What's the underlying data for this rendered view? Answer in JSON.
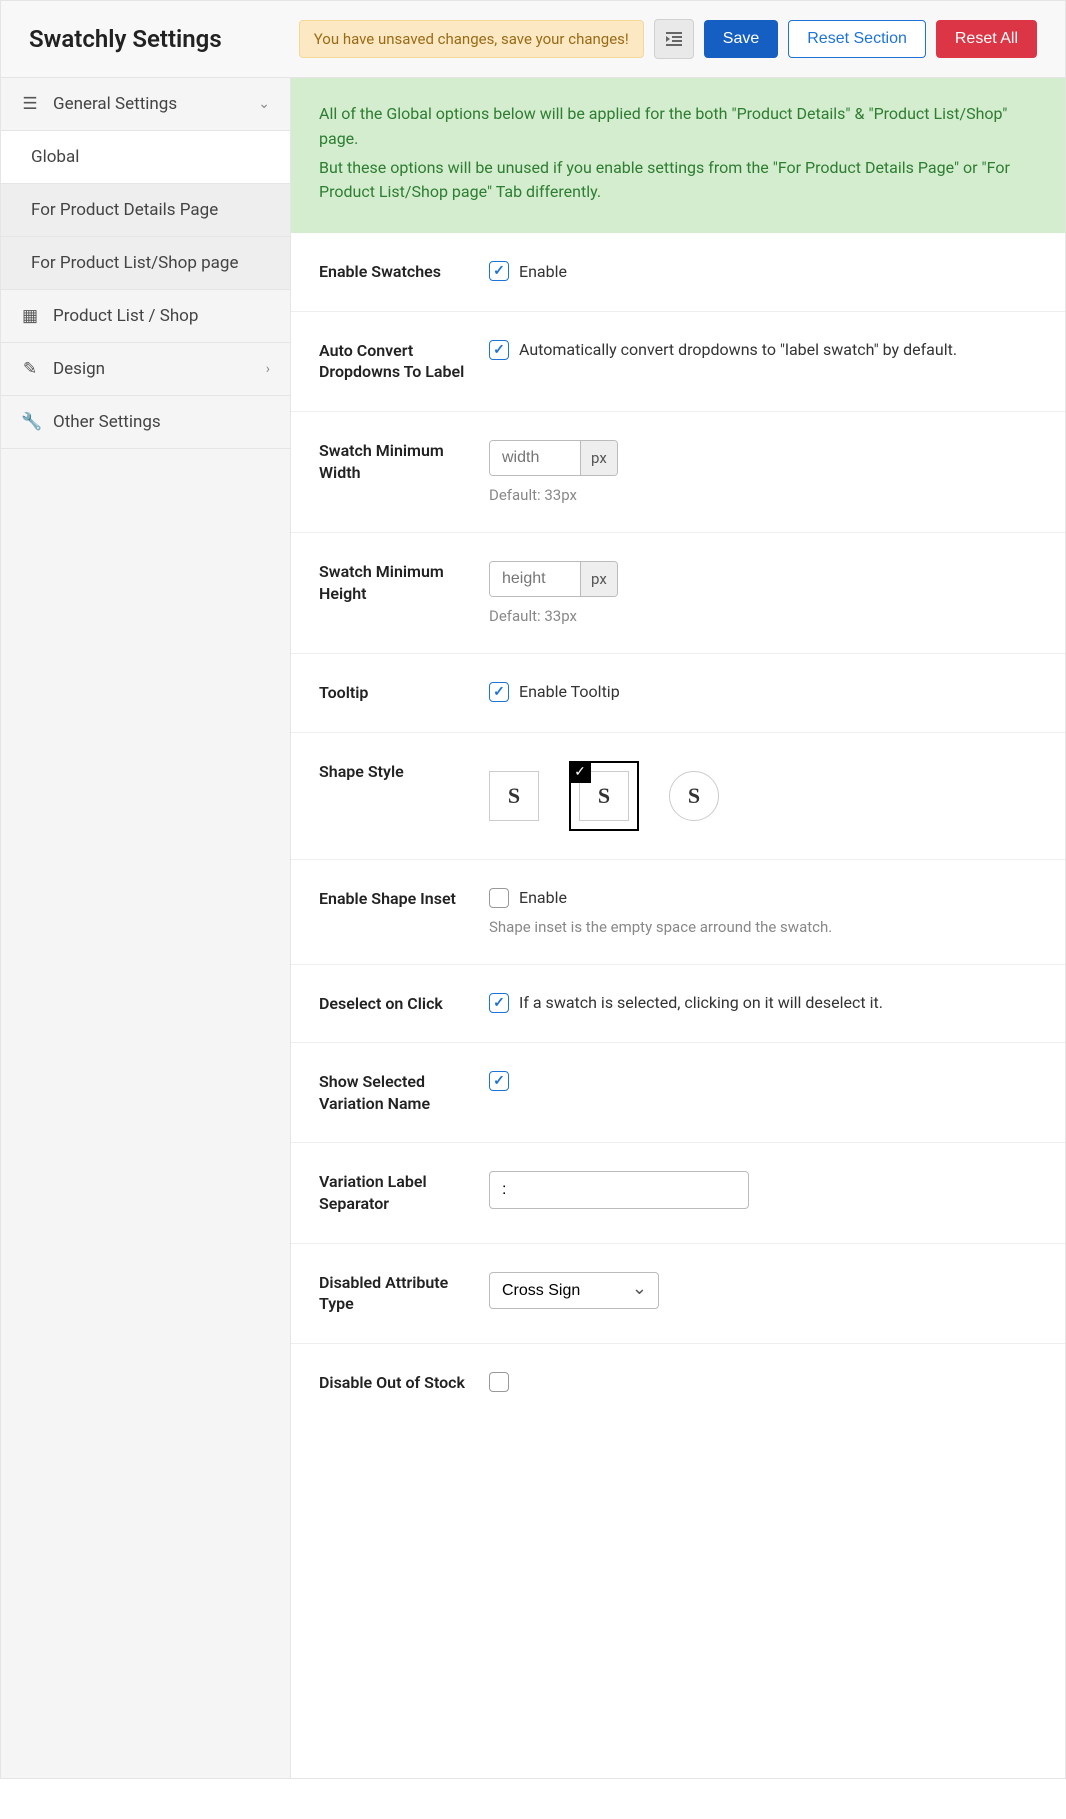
{
  "header": {
    "title": "Swatchly Settings",
    "unsaved_notice": "You have unsaved changes, save your changes!",
    "save": "Save",
    "reset_section": "Reset Section",
    "reset_all": "Reset All"
  },
  "sidebar": {
    "general": "General Settings",
    "global": "Global",
    "for_details": "For Product Details Page",
    "for_list": "For Product List/Shop page",
    "product_list": "Product List / Shop",
    "design": "Design",
    "other": "Other Settings"
  },
  "banner": {
    "line1": "All of the Global options below will be applied for the both \"Product Details\" & \"Product List/Shop\" page.",
    "line2": "But these options will be unused if you enable settings from the \"For Product Details Page\" or \"For Product List/Shop page\" Tab differently."
  },
  "settings": {
    "enable_swatches": {
      "label": "Enable Swatches",
      "checkbox_label": "Enable",
      "checked": true
    },
    "auto_convert": {
      "label": "Auto Convert Dropdowns To Label",
      "checkbox_label": "Automatically convert dropdowns to \"label swatch\" by default.",
      "checked": true
    },
    "min_width": {
      "label": "Swatch Minimum Width",
      "placeholder": "width",
      "unit": "px",
      "help": "Default: 33px"
    },
    "min_height": {
      "label": "Swatch Minimum Height",
      "placeholder": "height",
      "unit": "px",
      "help": "Default: 33px"
    },
    "tooltip": {
      "label": "Tooltip",
      "checkbox_label": "Enable Tooltip",
      "checked": true
    },
    "shape_style": {
      "label": "Shape Style",
      "glyph": "S"
    },
    "shape_inset": {
      "label": "Enable Shape Inset",
      "checkbox_label": "Enable",
      "help": "Shape inset is the empty space arround the swatch.",
      "checked": false
    },
    "deselect": {
      "label": "Deselect on Click",
      "checkbox_label": "If a swatch is selected, clicking on it will deselect it.",
      "checked": true
    },
    "show_selected": {
      "label": "Show Selected Variation Name",
      "checked": true
    },
    "separator": {
      "label": "Variation Label Separator",
      "value": ":"
    },
    "disabled_attr": {
      "label": "Disabled Attribute Type",
      "value": "Cross Sign"
    },
    "disable_oos": {
      "label": "Disable Out of Stock",
      "checked": false
    }
  }
}
